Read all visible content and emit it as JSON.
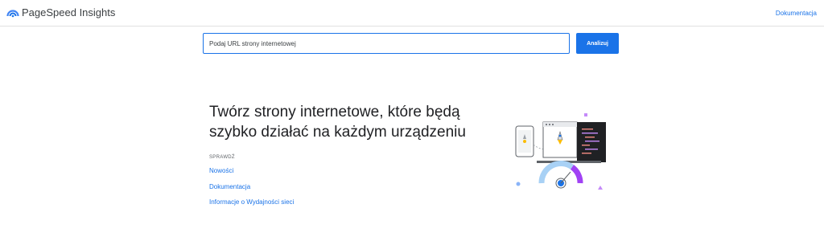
{
  "header": {
    "app_title": "PageSpeed Insights",
    "docs_link": "Dokumentacja",
    "logo_icon": "pagespeed-logo-icon"
  },
  "search": {
    "placeholder": "Podaj URL strony internetowej",
    "value": "",
    "button_label": "Analizuj"
  },
  "main": {
    "headline_line1": "Twórz strony internetowe, które będą",
    "headline_line2": "szybko działać na każdym urządzeniu",
    "check_label": "SPRAWDŹ",
    "links": [
      "Nowości",
      "Dokumentacja",
      "Informacje o Wydajności sieci"
    ],
    "illustration_icon": "devices-speed-gauge-illustration"
  },
  "colors": {
    "accent": "#1a73e8",
    "gauge_purple": "#a142f4",
    "gauge_light_blue": "#a8d1f5",
    "illustration_dark": "#202124"
  }
}
